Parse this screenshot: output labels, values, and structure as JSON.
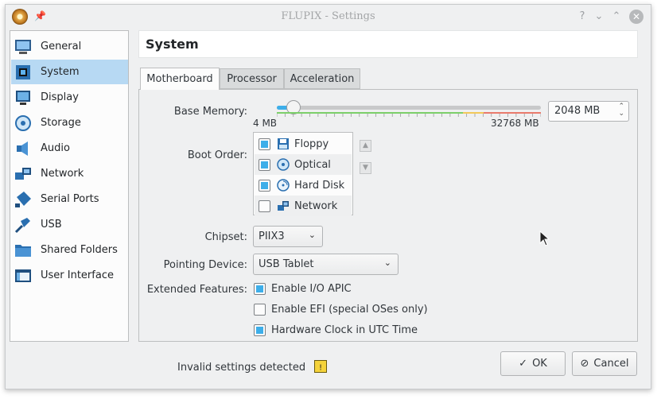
{
  "window": {
    "title": "FLUPIX - Settings"
  },
  "sidebar": {
    "items": [
      {
        "label": "General",
        "icon": "monitor-icon"
      },
      {
        "label": "System",
        "icon": "chip-icon"
      },
      {
        "label": "Display",
        "icon": "display-icon"
      },
      {
        "label": "Storage",
        "icon": "disk-icon"
      },
      {
        "label": "Audio",
        "icon": "speaker-icon"
      },
      {
        "label": "Network",
        "icon": "network-icon"
      },
      {
        "label": "Serial Ports",
        "icon": "serial-icon"
      },
      {
        "label": "USB",
        "icon": "usb-icon"
      },
      {
        "label": "Shared Folders",
        "icon": "folder-icon"
      },
      {
        "label": "User Interface",
        "icon": "window-icon"
      }
    ],
    "selected": "System"
  },
  "page": {
    "title": "System"
  },
  "tabs": [
    {
      "label": "Motherboard",
      "active": true
    },
    {
      "label": "Processor",
      "active": false
    },
    {
      "label": "Acceleration",
      "active": false
    }
  ],
  "motherboard": {
    "base_memory_label": "Base Memory:",
    "memory_min": "4 MB",
    "memory_max": "32768 MB",
    "memory_value": "2048 MB",
    "memory_fraction": 0.0625,
    "boot_order_label": "Boot Order:",
    "boot_items": [
      {
        "label": "Floppy",
        "checked": true
      },
      {
        "label": "Optical",
        "checked": true
      },
      {
        "label": "Hard Disk",
        "checked": true
      },
      {
        "label": "Network",
        "checked": false
      }
    ],
    "chipset_label": "Chipset:",
    "chipset_value": "PIIX3",
    "pointing_label": "Pointing Device:",
    "pointing_value": "USB Tablet",
    "extended_label": "Extended Features:",
    "features": [
      {
        "label": "Enable I/O APIC",
        "checked": true
      },
      {
        "label": "Enable EFI (special OSes only)",
        "checked": false
      },
      {
        "label": "Hardware Clock in UTC Time",
        "checked": true
      }
    ]
  },
  "footer": {
    "warning": "Invalid settings detected",
    "ok_label": "OK",
    "cancel_label": "Cancel"
  },
  "colors": {
    "accent": "#3daee9",
    "selection": "#b7d9f3"
  }
}
